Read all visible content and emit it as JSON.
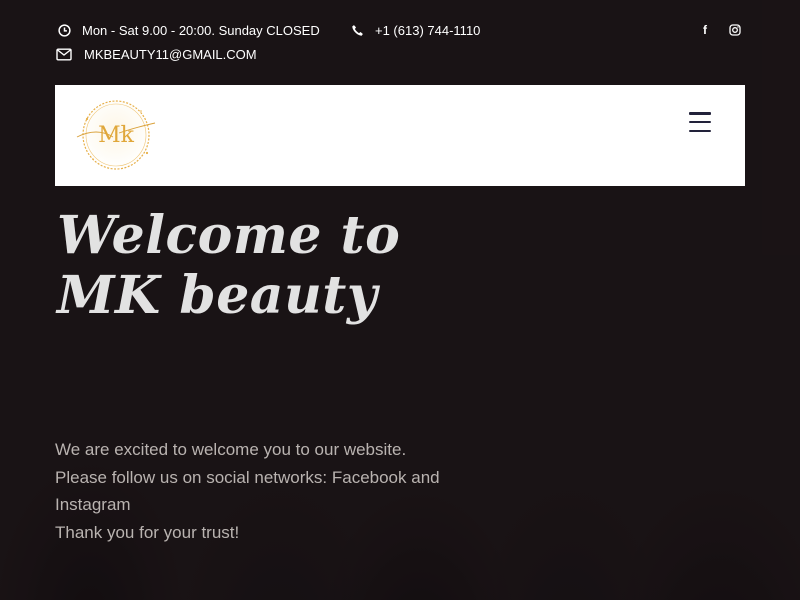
{
  "topbar": {
    "hours": "Mon - Sat 9.00 - 20:00. Sunday CLOSED",
    "phone": "+1 (613) 744-1110",
    "email": "MKBEAUTY11@GMAIL.COM",
    "social": [
      {
        "name": "facebook",
        "icon": "facebook-icon",
        "glyph": "f"
      },
      {
        "name": "instagram",
        "icon": "instagram-icon"
      }
    ]
  },
  "header": {
    "logo_text": "Mk",
    "logo_color": "#e0a73a",
    "menu_icon": "hamburger-menu-icon"
  },
  "hero": {
    "headline": "Welcome to MK beauty",
    "lines": [
      "We are excited to welcome you to our website.",
      "Please follow us on social networks: Facebook and Instagram",
      "Thank you for your trust!"
    ]
  },
  "colors": {
    "topbar_text": "#ffffff",
    "header_bg": "#ffffff",
    "hamburger": "#22223a",
    "headline": "#e2e2e2",
    "body_text": "#b9b3b0"
  }
}
